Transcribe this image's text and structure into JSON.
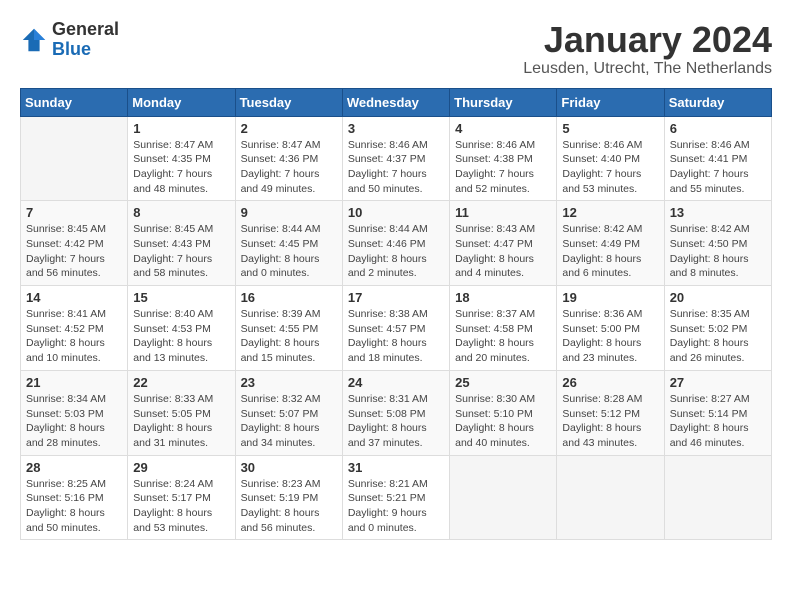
{
  "header": {
    "logo": {
      "general": "General",
      "blue": "Blue"
    },
    "title": "January 2024",
    "subtitle": "Leusden, Utrecht, The Netherlands"
  },
  "calendar": {
    "weekdays": [
      "Sunday",
      "Monday",
      "Tuesday",
      "Wednesday",
      "Thursday",
      "Friday",
      "Saturday"
    ],
    "weeks": [
      [
        {
          "day": "",
          "info": ""
        },
        {
          "day": "1",
          "info": "Sunrise: 8:47 AM\nSunset: 4:35 PM\nDaylight: 7 hours\nand 48 minutes."
        },
        {
          "day": "2",
          "info": "Sunrise: 8:47 AM\nSunset: 4:36 PM\nDaylight: 7 hours\nand 49 minutes."
        },
        {
          "day": "3",
          "info": "Sunrise: 8:46 AM\nSunset: 4:37 PM\nDaylight: 7 hours\nand 50 minutes."
        },
        {
          "day": "4",
          "info": "Sunrise: 8:46 AM\nSunset: 4:38 PM\nDaylight: 7 hours\nand 52 minutes."
        },
        {
          "day": "5",
          "info": "Sunrise: 8:46 AM\nSunset: 4:40 PM\nDaylight: 7 hours\nand 53 minutes."
        },
        {
          "day": "6",
          "info": "Sunrise: 8:46 AM\nSunset: 4:41 PM\nDaylight: 7 hours\nand 55 minutes."
        }
      ],
      [
        {
          "day": "7",
          "info": "Sunrise: 8:45 AM\nSunset: 4:42 PM\nDaylight: 7 hours\nand 56 minutes."
        },
        {
          "day": "8",
          "info": "Sunrise: 8:45 AM\nSunset: 4:43 PM\nDaylight: 7 hours\nand 58 minutes."
        },
        {
          "day": "9",
          "info": "Sunrise: 8:44 AM\nSunset: 4:45 PM\nDaylight: 8 hours\nand 0 minutes."
        },
        {
          "day": "10",
          "info": "Sunrise: 8:44 AM\nSunset: 4:46 PM\nDaylight: 8 hours\nand 2 minutes."
        },
        {
          "day": "11",
          "info": "Sunrise: 8:43 AM\nSunset: 4:47 PM\nDaylight: 8 hours\nand 4 minutes."
        },
        {
          "day": "12",
          "info": "Sunrise: 8:42 AM\nSunset: 4:49 PM\nDaylight: 8 hours\nand 6 minutes."
        },
        {
          "day": "13",
          "info": "Sunrise: 8:42 AM\nSunset: 4:50 PM\nDaylight: 8 hours\nand 8 minutes."
        }
      ],
      [
        {
          "day": "14",
          "info": "Sunrise: 8:41 AM\nSunset: 4:52 PM\nDaylight: 8 hours\nand 10 minutes."
        },
        {
          "day": "15",
          "info": "Sunrise: 8:40 AM\nSunset: 4:53 PM\nDaylight: 8 hours\nand 13 minutes."
        },
        {
          "day": "16",
          "info": "Sunrise: 8:39 AM\nSunset: 4:55 PM\nDaylight: 8 hours\nand 15 minutes."
        },
        {
          "day": "17",
          "info": "Sunrise: 8:38 AM\nSunset: 4:57 PM\nDaylight: 8 hours\nand 18 minutes."
        },
        {
          "day": "18",
          "info": "Sunrise: 8:37 AM\nSunset: 4:58 PM\nDaylight: 8 hours\nand 20 minutes."
        },
        {
          "day": "19",
          "info": "Sunrise: 8:36 AM\nSunset: 5:00 PM\nDaylight: 8 hours\nand 23 minutes."
        },
        {
          "day": "20",
          "info": "Sunrise: 8:35 AM\nSunset: 5:02 PM\nDaylight: 8 hours\nand 26 minutes."
        }
      ],
      [
        {
          "day": "21",
          "info": "Sunrise: 8:34 AM\nSunset: 5:03 PM\nDaylight: 8 hours\nand 28 minutes."
        },
        {
          "day": "22",
          "info": "Sunrise: 8:33 AM\nSunset: 5:05 PM\nDaylight: 8 hours\nand 31 minutes."
        },
        {
          "day": "23",
          "info": "Sunrise: 8:32 AM\nSunset: 5:07 PM\nDaylight: 8 hours\nand 34 minutes."
        },
        {
          "day": "24",
          "info": "Sunrise: 8:31 AM\nSunset: 5:08 PM\nDaylight: 8 hours\nand 37 minutes."
        },
        {
          "day": "25",
          "info": "Sunrise: 8:30 AM\nSunset: 5:10 PM\nDaylight: 8 hours\nand 40 minutes."
        },
        {
          "day": "26",
          "info": "Sunrise: 8:28 AM\nSunset: 5:12 PM\nDaylight: 8 hours\nand 43 minutes."
        },
        {
          "day": "27",
          "info": "Sunrise: 8:27 AM\nSunset: 5:14 PM\nDaylight: 8 hours\nand 46 minutes."
        }
      ],
      [
        {
          "day": "28",
          "info": "Sunrise: 8:25 AM\nSunset: 5:16 PM\nDaylight: 8 hours\nand 50 minutes."
        },
        {
          "day": "29",
          "info": "Sunrise: 8:24 AM\nSunset: 5:17 PM\nDaylight: 8 hours\nand 53 minutes."
        },
        {
          "day": "30",
          "info": "Sunrise: 8:23 AM\nSunset: 5:19 PM\nDaylight: 8 hours\nand 56 minutes."
        },
        {
          "day": "31",
          "info": "Sunrise: 8:21 AM\nSunset: 5:21 PM\nDaylight: 9 hours\nand 0 minutes."
        },
        {
          "day": "",
          "info": ""
        },
        {
          "day": "",
          "info": ""
        },
        {
          "day": "",
          "info": ""
        }
      ]
    ]
  }
}
